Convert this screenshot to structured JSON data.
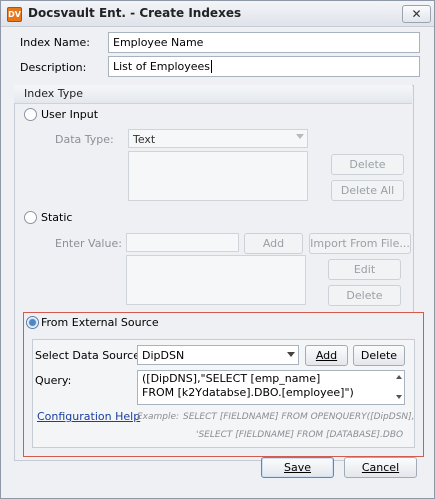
{
  "window": {
    "app_icon_text": "DV",
    "title": "Docsvault Ent. - Create Indexes",
    "close_symbol": "✕"
  },
  "form": {
    "index_name_label": "Index Name:",
    "index_name_value": "Employee Name",
    "description_label": "Description:",
    "description_value": "List of Employees"
  },
  "index_type": {
    "caption": "Index Type",
    "user_input": {
      "label": "User Input",
      "data_type_label": "Data Type:",
      "data_type_value": "Text",
      "delete_label": "Delete",
      "delete_all_label": "Delete All"
    },
    "static": {
      "label": "Static",
      "enter_value_label": "Enter Value:",
      "add_label": "Add",
      "import_label": "Import From File...",
      "edit_label": "Edit",
      "delete_label": "Delete"
    },
    "external": {
      "label": "From External Source",
      "select_source_label": "Select Data Source:",
      "source_value": "DipDSN",
      "add_label": "Add",
      "delete_label": "Delete",
      "query_label": "Query:",
      "query_line1": "([DipDNS],\"SELECT [emp_name]",
      "query_line2": "FROM [k2Ydatabse].DBO.[employee]\")",
      "config_help_label": "Configuration Help",
      "example_label": "Example:",
      "example_line1": "SELECT [FIELDNAME] FROM OPENQUERY([DipDSN],",
      "example_line2": "'SELECT [FIELDNAME] FROM [DATABASE].DBO"
    }
  },
  "footer": {
    "save_label": "Save",
    "cancel_label": "Cancel"
  }
}
